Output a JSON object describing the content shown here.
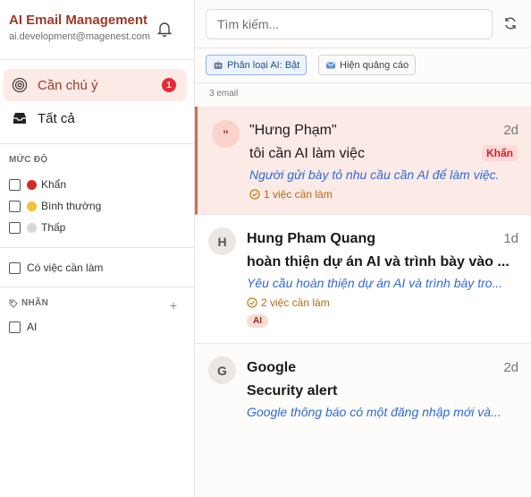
{
  "sidebar": {
    "title": "AI Email Management",
    "account": "ai.development@magenest.com",
    "nav": [
      {
        "label": "Cần chú ý",
        "count": "1",
        "icon": "target-icon"
      },
      {
        "label": "Tất cả",
        "icon": "inbox-icon"
      }
    ],
    "levels": {
      "heading": "MỨC ĐỘ",
      "items": [
        {
          "label": "Khẩn",
          "color": "#d62828"
        },
        {
          "label": "Bình thường",
          "color": "#f2c230"
        },
        {
          "label": "Thấp",
          "color": "#d8d8d8"
        }
      ]
    },
    "todo_filter": "Có việc cần làm",
    "labels": {
      "heading": "NHÃN",
      "items": [
        "AI"
      ]
    }
  },
  "main": {
    "search_placeholder": "Tìm kiếm...",
    "chips": {
      "classify": "Phân loại AI: Bật",
      "ads": "Hiện quảng cáo"
    },
    "count_text": "3 email",
    "emails": [
      {
        "avatar": "\"",
        "sender": "\"Hưng Phạm\"",
        "date": "2d",
        "subject": "tôi cần AI làm việc",
        "badge": "Khẩn",
        "summary": "Người gửi bày tỏ nhu cầu cần AI để làm việc.",
        "tasks": "1 việc cần làm"
      },
      {
        "avatar": "H",
        "sender": "Hung Pham Quang",
        "date": "1d",
        "subject": "hoàn thiện dự án AI và trình bày vào ...",
        "summary": "Yêu cầu hoàn thiện dự án AI và trình bày tro...",
        "tasks": "2 việc cần làm",
        "tag": "AI"
      },
      {
        "avatar": "G",
        "sender": "Google",
        "date": "2d",
        "subject": "Security alert",
        "summary": "Google thông báo có một đăng nhập mới và..."
      }
    ]
  },
  "colors": {
    "brand": "#9b3b26",
    "accent_bg": "#fbeae6",
    "summary": "#2e6ad6",
    "tasks": "#b86a14",
    "urgent": "#d0232f"
  }
}
